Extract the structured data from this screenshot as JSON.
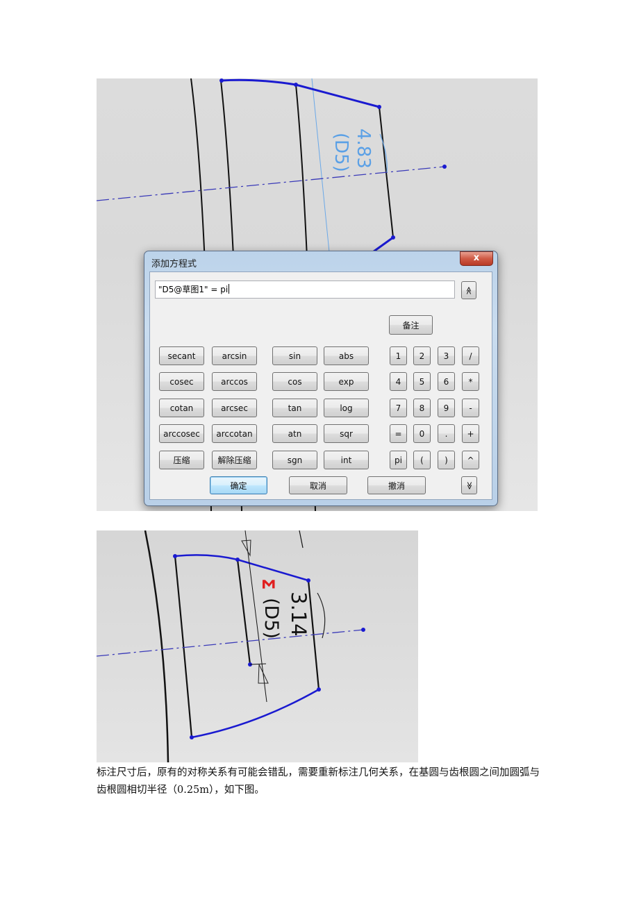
{
  "figure1": {
    "dimension_label": "4.83",
    "dimension_name": "(D5)"
  },
  "dialog": {
    "title": "添加方程式",
    "close_label": "x",
    "equation_value": "\"D5@草图1\" = pi",
    "expand_up_label": "≪",
    "note_button": "备注",
    "function_buttons": [
      [
        "secant",
        "arcsin",
        "sin",
        "abs"
      ],
      [
        "cosec",
        "arccos",
        "cos",
        "exp"
      ],
      [
        "cotan",
        "arcsec",
        "tan",
        "log"
      ],
      [
        "arccosec",
        "arccotan",
        "atn",
        "sqr"
      ],
      [
        "压缩",
        "解除压缩",
        "sgn",
        "int"
      ]
    ],
    "keypad_buttons": [
      [
        "1",
        "2",
        "3",
        "/"
      ],
      [
        "4",
        "5",
        "6",
        "*"
      ],
      [
        "7",
        "8",
        "9",
        "-"
      ],
      [
        "=",
        "0",
        ".",
        "+"
      ],
      [
        "pi",
        "(",
        ")",
        "^"
      ]
    ],
    "ok_button": "确定",
    "cancel_button": "取消",
    "undo_button": "撤消",
    "expand_down_label": "≫"
  },
  "figure2": {
    "dimension_label": "3.14",
    "dimension_name": "(D5)",
    "equation_marker": "Σ"
  },
  "paragraph": "标注尺寸后，原有的对称关系有可能会错乱，需要重新标注几何关系，在基圆与齿根圆之间加圆弧与齿根圆相切半径（0.25m），如下图。",
  "colors": {
    "sketch_blue": "#1a1ad0",
    "dimension_blue": "#5aa0e6",
    "equation_red": "#e02020",
    "ok_button_border": "#3c7fb1"
  }
}
